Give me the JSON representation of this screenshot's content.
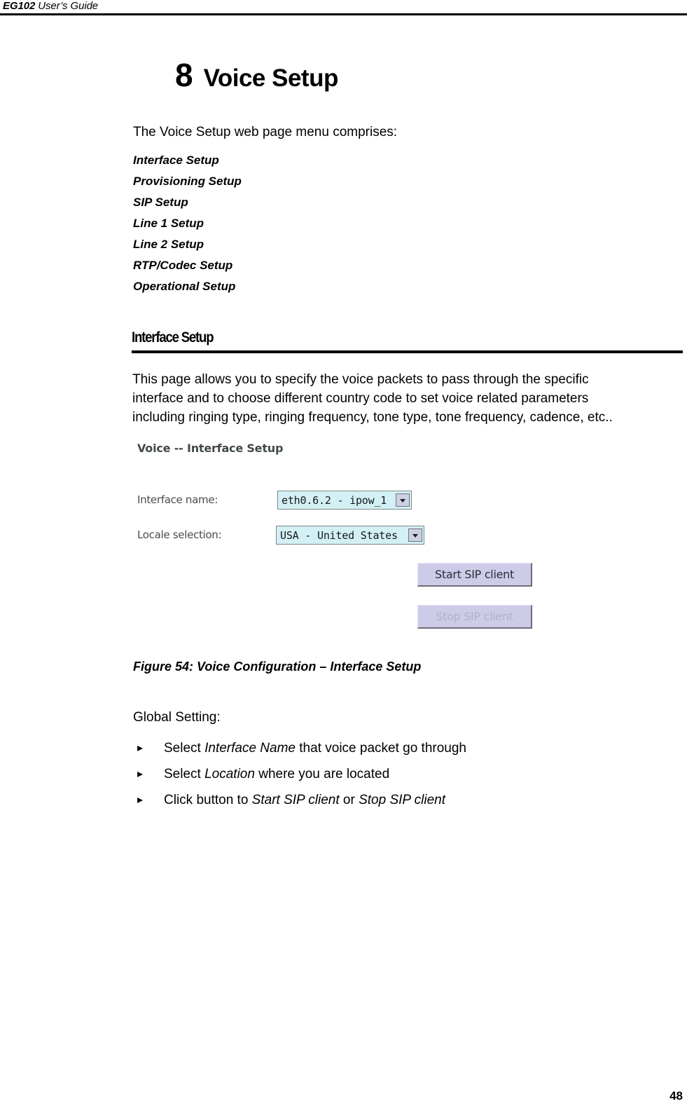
{
  "header": {
    "model": "EG102",
    "guide": " User’s Guide"
  },
  "chapter": {
    "number": "8",
    "name": "Voice Setup"
  },
  "intro": {
    "text": "The Voice Setup web page menu comprises:"
  },
  "menu": {
    "items": [
      "Interface Setup",
      "Provisioning Setup",
      "SIP Setup",
      "Line 1 Setup",
      "Line 2 Setup",
      "RTP/Codec Setup",
      "Operational Setup"
    ]
  },
  "section": {
    "heading": "Interface Setup",
    "paragraph_line1": "This page allows you to specify the voice packets to pass through the specific",
    "paragraph_line2": "interface and to choose different country code to set voice related parameters",
    "paragraph_line3": "including ringing type, ringing frequency, tone type, tone frequency, cadence, etc.."
  },
  "screenshot": {
    "title": "Voice -- Interface Setup",
    "fields": [
      {
        "label": "Interface name:",
        "value": "eth0.6.2 - ipow_1",
        "arrow_icon": "chevron-down-icon"
      },
      {
        "label": "Locale selection:",
        "value": "USA - United States",
        "arrow_icon": "chevron-down-icon"
      }
    ],
    "buttons": [
      {
        "label": "Start SIP client",
        "state": "enabled"
      },
      {
        "label": "Stop SIP client",
        "state": "disabled"
      }
    ],
    "colors": {
      "select_background": "#d3f0f4",
      "select_border": "#7b8a8c",
      "button_background": "#cdcbe8",
      "button_text": "#2c2c38",
      "button_disabled_text": "#b2b0cc",
      "title_text": "#414a42",
      "label_text": "#4a4a48"
    }
  },
  "figure": {
    "caption": "Figure 54: Voice Configuration – Interface Setup"
  },
  "global_setting": {
    "heading": "Global Setting:",
    "bullet_marker": "▸",
    "bullets": [
      {
        "prefix": "Select ",
        "emphasis": "Interface Name",
        "middle": " that voice packet go through",
        "emphasis2": "",
        "suffix": ""
      },
      {
        "prefix": "Select ",
        "emphasis": "Location",
        "middle": " where you are located",
        "emphasis2": "",
        "suffix": ""
      },
      {
        "prefix": "Click button to ",
        "emphasis": "Start SIP client",
        "middle": " or ",
        "emphasis2": "Stop SIP client",
        "suffix": ""
      }
    ]
  },
  "footer": {
    "page_number": "48"
  }
}
